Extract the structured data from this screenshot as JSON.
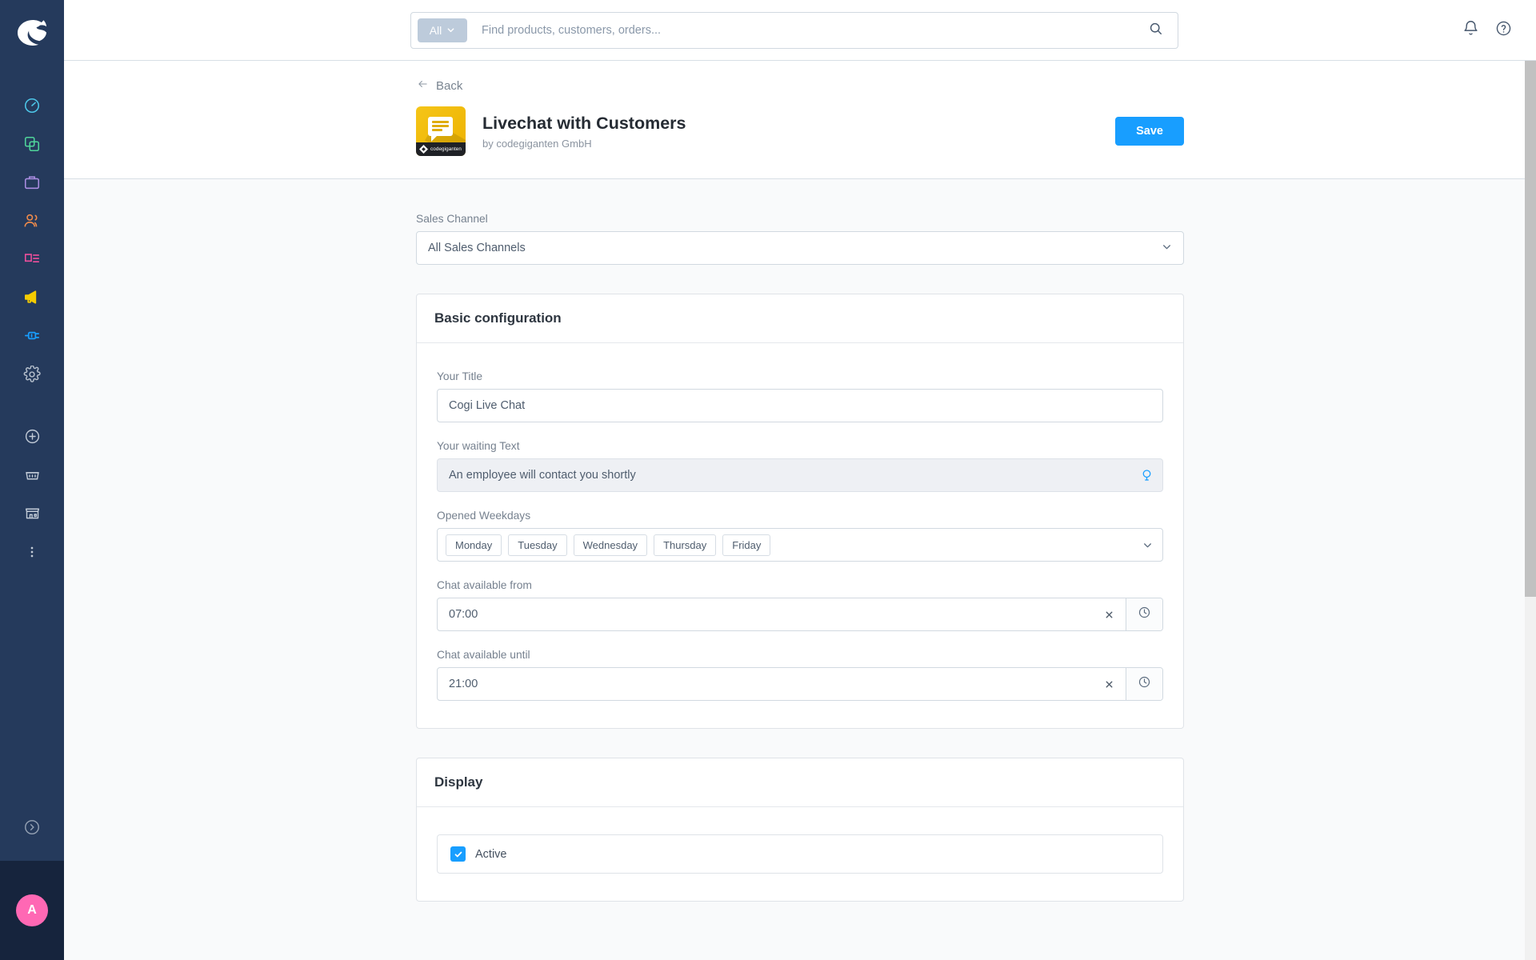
{
  "sidebar": {
    "logo_name": "shopware-logo",
    "items": [
      {
        "name": "dashboard",
        "icon": "gauge-icon",
        "color": "#4dc6e8"
      },
      {
        "name": "catalogues",
        "icon": "copy-squares-icon",
        "color": "#4fd49a"
      },
      {
        "name": "orders",
        "icon": "briefcase-icon",
        "color": "#a98ce0"
      },
      {
        "name": "customers",
        "icon": "people-icon",
        "color": "#f08b4b"
      },
      {
        "name": "content",
        "icon": "content-lines-icon",
        "color": "#ef4f9c"
      },
      {
        "name": "marketing",
        "icon": "megaphone-icon",
        "color": "#f5cc00"
      },
      {
        "name": "extensions",
        "icon": "plug-icon",
        "color": "#189eff"
      },
      {
        "name": "settings",
        "icon": "gear-icon",
        "color": "#b6c0cd"
      }
    ],
    "actions": [
      {
        "name": "add",
        "icon": "plus-circle-icon"
      },
      {
        "name": "shop-basket",
        "icon": "basket-icon"
      },
      {
        "name": "storefront",
        "icon": "store-icon"
      },
      {
        "name": "more",
        "icon": "kebab-menu-icon"
      }
    ],
    "expand_icon": "chevron-right-circle-icon",
    "avatar_initial": "A"
  },
  "search": {
    "scope_label": "All",
    "placeholder": "Find products, customers, orders...",
    "value": "",
    "scope_caret_icon": "chevron-down-icon",
    "submit_icon": "search-icon"
  },
  "topbar": {
    "notifications_icon": "bell-icon",
    "help_icon": "question-circle-icon"
  },
  "header": {
    "back_label": "Back",
    "back_icon": "arrow-left-icon",
    "app_title": "Livechat with Customers",
    "app_vendor": "by codegiganten GmbH",
    "app_icon_brand": "codegiganten",
    "app_icon_name": "chat-bubble-app-icon",
    "save_label": "Save"
  },
  "sales_channel": {
    "label": "Sales Channel",
    "value": "All Sales Channels",
    "caret_icon": "chevron-down-icon"
  },
  "basic_configuration": {
    "title": "Basic configuration",
    "title_field": {
      "label": "Your Title",
      "value": "Cogi Live Chat"
    },
    "waiting_text_field": {
      "label": "Your waiting Text",
      "value": "An employee will contact you shortly",
      "translate_icon": "globe-icon"
    },
    "weekdays_field": {
      "label": "Opened Weekdays",
      "selected": [
        "Monday",
        "Tuesday",
        "Wednesday",
        "Thursday",
        "Friday"
      ],
      "caret_icon": "chevron-down-icon"
    },
    "available_from": {
      "label": "Chat available from",
      "value": "07:00",
      "clear_icon": "close-icon",
      "picker_icon": "clock-icon"
    },
    "available_until": {
      "label": "Chat available until",
      "value": "21:00",
      "clear_icon": "close-icon",
      "picker_icon": "clock-icon"
    }
  },
  "display": {
    "title": "Display",
    "active_checkbox": {
      "label": "Active",
      "checked": true,
      "check_icon": "check-icon"
    }
  },
  "colors": {
    "sidebar_bg": "#253a5c",
    "primary_blue": "#189eff",
    "avatar_pink": "#ff68b4",
    "app_icon_yellow": "#f5c518"
  }
}
